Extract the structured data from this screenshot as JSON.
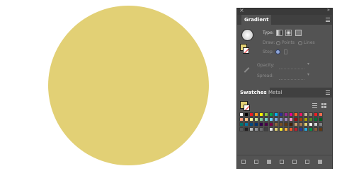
{
  "artboard": {
    "circle_color": "#E2D075"
  },
  "dock": {
    "close_glyph": "×",
    "collapse_glyph": "»"
  },
  "gradient_panel": {
    "tab_label": "Gradient",
    "type_label": "Type:",
    "draw_label": "Draw:",
    "points_label": "Points",
    "lines_label": "Lines",
    "stop_label": "Stop:",
    "opacity_label": "Opacity:",
    "spread_label": "Spread:",
    "fill_color": "#E2D075",
    "icons": [
      "gradient-preview-icon",
      "linear-gradient-icon",
      "radial-gradient-icon",
      "freeform-gradient-icon",
      "eyedropper-icon",
      "delete-stop-icon",
      "panel-menu-icon"
    ]
  },
  "swatches_panel": {
    "tabs": [
      "Swatches",
      "Metal"
    ],
    "fill_color": "#E2D075",
    "view_icons": [
      "list-view-icon",
      "grid-view-icon"
    ],
    "rows": [
      [
        "#ffffff",
        "#000000",
        "#ed1c24",
        "#f7941d",
        "#fff200",
        "#8dc63f",
        "#00a651",
        "#00aeef",
        "#2e3192",
        "#92278f",
        "#ec008c",
        "#f26522",
        "#ed145b",
        "#c2b59b",
        "#998675",
        "#ed1c24",
        "#f26c4f"
      ],
      [
        "#f7977a",
        "#fdc68a",
        "#fff799",
        "#c4df9b",
        "#82ca9c",
        "#7bcdc8",
        "#6dcff6",
        "#7da7d9",
        "#8493ca",
        "#a187be",
        "#f49ac2",
        "#9e0b0f",
        "#a0410d",
        "#aba000",
        "#598527",
        "#007236",
        "#005e20"
      ],
      [
        "#00746b",
        "#0076a3",
        "#004a80",
        "#003471",
        "#32004b",
        "#4b0049",
        "#7b0046",
        "#8c6239",
        "#754c24",
        "#603913",
        "#42210b",
        "#c69c6d",
        "#a67c52",
        "#e2d075",
        "#ffffff",
        "#d1d3d4",
        "#808285"
      ],
      [
        "#58595b",
        "#231f20",
        "#bcbec0",
        "#939598",
        "#6d6e71",
        "#414042",
        "#e6e7e8",
        "#e2d075",
        "#f9ed32",
        "#fbb040",
        "#f15a29",
        "#be1e2d",
        "#2b3990",
        "#27aae1",
        "#009444",
        "#8b5e3c",
        "#603913"
      ]
    ],
    "footer_icons": [
      "swatch-libraries-icon",
      "add-selected-swatches-icon",
      "show-swatch-kinds-icon",
      "swatch-options-icon",
      "new-color-group-icon",
      "new-swatch-icon",
      "delete-swatch-icon"
    ]
  }
}
